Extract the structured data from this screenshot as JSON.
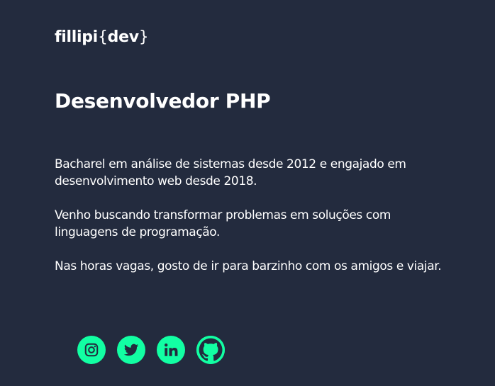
{
  "logo": {
    "name": "fillipi",
    "open_brace": "{",
    "suffix": "dev",
    "close_brace": "}"
  },
  "headline": "Desenvolvedor PHP",
  "bio": [
    "Bacharel em análise de sistemas desde 2012 e engajado em desenvolvimento web desde 2018.",
    "Venho buscando transformar problemas em soluções com linguagens de programação.",
    "Nas horas vagas, gosto de ir para barzinho com os amigos e viajar."
  ],
  "socials": [
    {
      "icon": "instagram-icon"
    },
    {
      "icon": "twitter-icon"
    },
    {
      "icon": "linkedin-icon"
    },
    {
      "icon": "github-icon"
    }
  ],
  "colors": {
    "background": "#232b3e",
    "text": "#ffffff",
    "accent": "#12ffa3",
    "icon_glyph": "#232b3e"
  }
}
